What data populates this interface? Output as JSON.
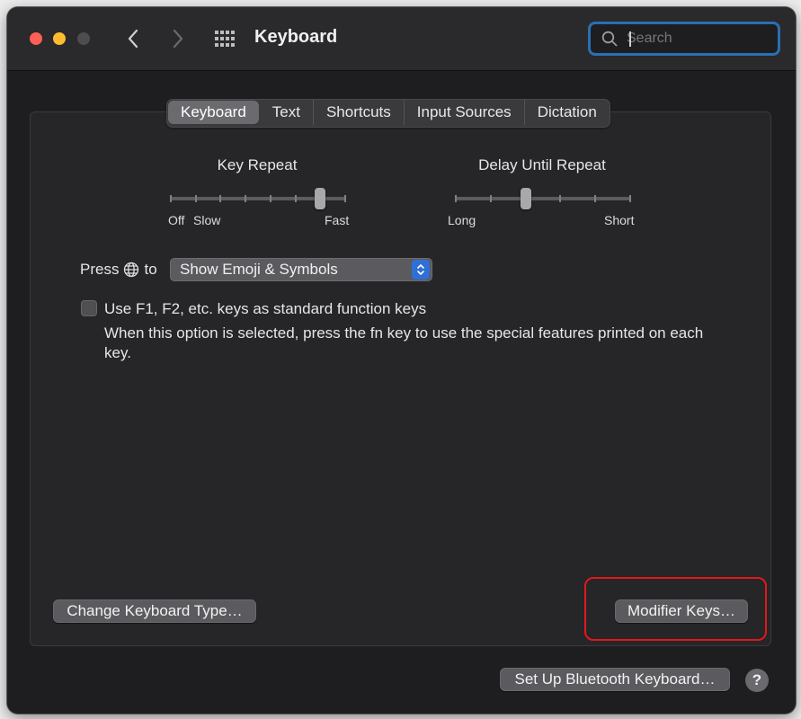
{
  "window": {
    "title": "Keyboard"
  },
  "search": {
    "placeholder": "Search"
  },
  "tabs": [
    {
      "label": "Keyboard",
      "active": true
    },
    {
      "label": "Text"
    },
    {
      "label": "Shortcuts"
    },
    {
      "label": "Input Sources"
    },
    {
      "label": "Dictation"
    }
  ],
  "key_repeat": {
    "title": "Key Repeat",
    "labels": {
      "off": "Off",
      "slow": "Slow",
      "fast": "Fast"
    },
    "ticks": 8,
    "level_fraction": 0.857
  },
  "delay_until_repeat": {
    "title": "Delay Until Repeat",
    "labels": {
      "long": "Long",
      "short": "Short"
    },
    "ticks": 6,
    "level_fraction": 0.4
  },
  "press_globe": {
    "prefix": "Press",
    "suffix": "to",
    "selected": "Show Emoji & Symbols"
  },
  "fn_keys": {
    "label": "Use F1, F2, etc. keys as standard function keys",
    "help": "When this option is selected, press the fn key to use the special features printed on each key.",
    "checked": false
  },
  "buttons": {
    "change_type": "Change Keyboard Type…",
    "modifier": "Modifier Keys…",
    "bluetooth": "Set Up Bluetooth Keyboard…",
    "help": "?"
  },
  "colors": {
    "accent": "#2f6fd6",
    "highlight": "#e0191d",
    "search_focus": "#2a6fb3"
  }
}
